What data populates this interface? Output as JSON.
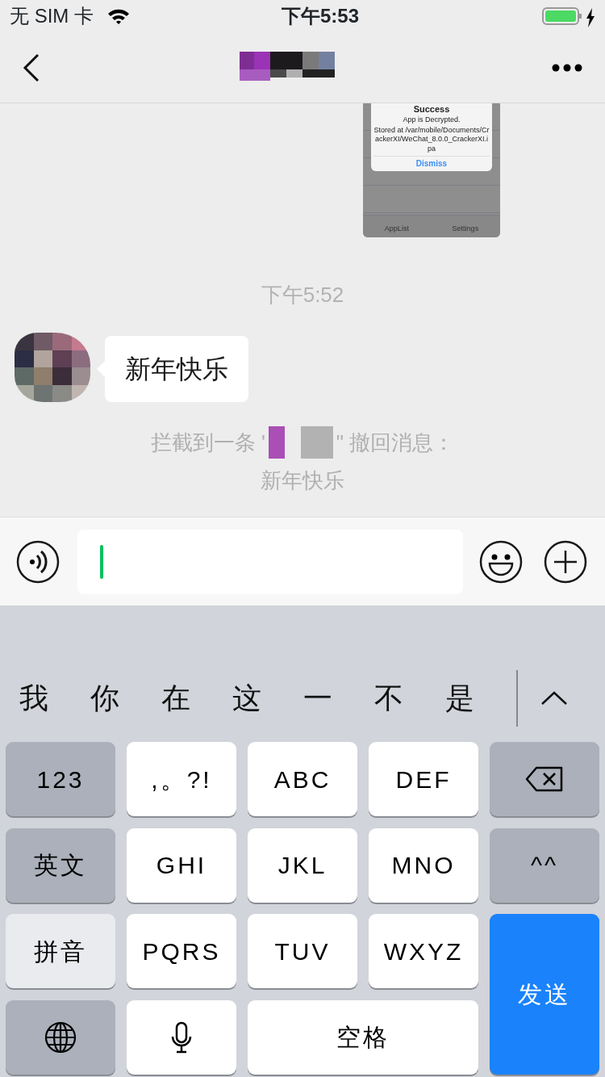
{
  "status_bar": {
    "carrier": "无 SIM 卡",
    "time": "下午5:53",
    "charging": true
  },
  "messages": [
    {
      "kind": "image",
      "alert_title": "Success",
      "alert_message": "App is Decrypted.",
      "alert_detail": "Stored at /var/mobile/Documents/CrackerXI/WeChat_8.0.0_CrackerXI.ipa",
      "alert_button": "Dismiss",
      "tabs": [
        "AppList",
        "Settings"
      ]
    },
    {
      "kind": "time",
      "text": "下午5:52"
    },
    {
      "kind": "text",
      "text": "新年快乐"
    },
    {
      "kind": "system",
      "before": "拦截到一条 '",
      "after": "\" 撤回消息：",
      "line2": "新年快乐"
    }
  ],
  "candidates": [
    "我",
    "你",
    "在",
    "这",
    "一",
    "不",
    "是"
  ],
  "keys": [
    {
      "kind": "function",
      "label": "123"
    },
    {
      "kind": "letter",
      "label": ",。?!"
    },
    {
      "kind": "letter",
      "label": "ABC"
    },
    {
      "kind": "letter",
      "label": "DEF"
    },
    {
      "kind": "delete"
    },
    {
      "kind": "function",
      "label": "英文"
    },
    {
      "kind": "letter",
      "label": "GHI"
    },
    {
      "kind": "letter",
      "label": "JKL"
    },
    {
      "kind": "letter",
      "label": "MNO"
    },
    {
      "kind": "function",
      "label": "^^"
    },
    {
      "kind": "function-lit",
      "label": "拼音"
    },
    {
      "kind": "letter",
      "label": "PQRS"
    },
    {
      "kind": "letter",
      "label": "TUV"
    },
    {
      "kind": "letter",
      "label": "WXYZ"
    },
    {
      "kind": "send",
      "label": "发送"
    },
    {
      "kind": "globe"
    },
    {
      "kind": "mic"
    },
    {
      "kind": "space",
      "label": "空格"
    }
  ]
}
